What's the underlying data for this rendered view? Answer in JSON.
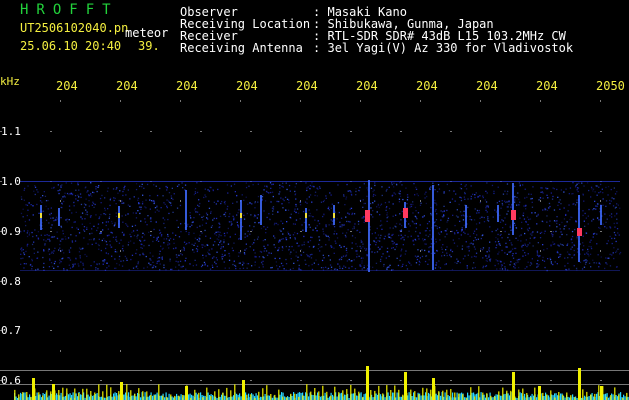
{
  "header": {
    "app_title": "HROFFT",
    "file_name": "UT2506102040.pn",
    "meteor_label": "meteor",
    "datetime": "25.06.10 20:40",
    "count": "39."
  },
  "info": [
    {
      "label": "Observer",
      "sep": ":",
      "value": "Masaki Kano"
    },
    {
      "label": "Receiving Location",
      "sep": ":",
      "value": "Shibukawa, Gunma, Japan"
    },
    {
      "label": "Receiver",
      "sep": ":",
      "value": "RTL-SDR SDR# 43dB L15 103.2MHz CW"
    },
    {
      "label": "Receiving Antenna",
      "sep": ":",
      "value": "3el Yagi(V) Az 330 for Vladivostok"
    }
  ],
  "axis": {
    "unit": "kHz",
    "y_ticks": [
      "1.1",
      "1.0",
      "0.9",
      "0.8",
      "0.7",
      "0.6"
    ],
    "x_ticks": [
      "204",
      "204",
      "204",
      "204",
      "204",
      "204",
      "204",
      "204",
      "204",
      "2050"
    ]
  },
  "colors": {
    "header_green": "#22d33b",
    "header_yellow": "#f4ef40",
    "grid_gray": "#777777",
    "baseline_cyan": "#2ad6ff",
    "baseline_yellow": "#f0f000",
    "echo_red": "#ff3a60"
  }
}
